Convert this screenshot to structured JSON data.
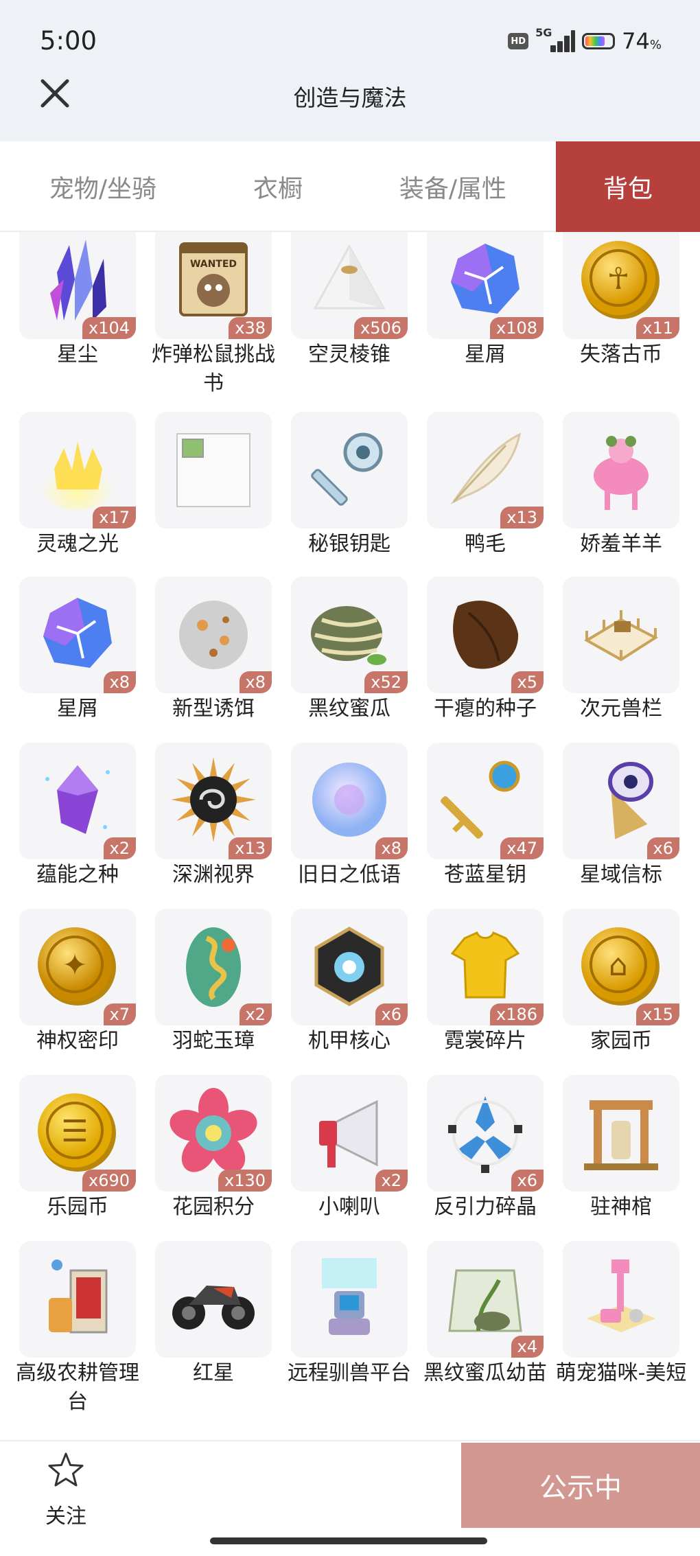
{
  "status_bar": {
    "time": "5:00",
    "hd": "HD",
    "network": "5G",
    "battery": "74",
    "battery_unit": "%"
  },
  "header": {
    "title": "创造与魔法"
  },
  "tabs": [
    {
      "label": "宠物/坐骑"
    },
    {
      "label": "衣橱"
    },
    {
      "label": "装备/属性"
    },
    {
      "label": "背包",
      "active": true
    }
  ],
  "items": [
    {
      "name": "星尘",
      "qty": "x104",
      "icon": "crystal-cluster-icon"
    },
    {
      "name": "炸弹松鼠挑战书",
      "qty": "x38",
      "icon": "wanted-scroll-icon"
    },
    {
      "name": "空灵棱锥",
      "qty": "x506",
      "icon": "pyramid-icon"
    },
    {
      "name": "星屑",
      "qty": "x108",
      "icon": "star-shard-icon"
    },
    {
      "name": "失落古币",
      "qty": "x11",
      "icon": "ankh-coin-icon"
    },
    {
      "name": "灵魂之光",
      "qty": "x17",
      "icon": "soul-light-icon"
    },
    {
      "name": "",
      "qty": "",
      "icon": "broken-image-icon"
    },
    {
      "name": "秘银钥匙",
      "qty": "",
      "icon": "mithril-key-icon"
    },
    {
      "name": "鸭毛",
      "qty": "x13",
      "icon": "feather-icon"
    },
    {
      "name": "娇羞羊羊",
      "qty": "",
      "icon": "pink-sheep-icon"
    },
    {
      "name": "星屑",
      "qty": "x8",
      "icon": "star-shard-icon"
    },
    {
      "name": "新型诱饵",
      "qty": "x8",
      "icon": "bait-ball-icon"
    },
    {
      "name": "黑纹蜜瓜",
      "qty": "x52",
      "icon": "melon-icon"
    },
    {
      "name": "干瘪的种子",
      "qty": "x5",
      "icon": "dried-seed-icon"
    },
    {
      "name": "次元兽栏",
      "qty": "",
      "icon": "fence-pen-icon"
    },
    {
      "name": "蕴能之种",
      "qty": "x2",
      "icon": "purple-crystal-icon"
    },
    {
      "name": "深渊视界",
      "qty": "x13",
      "icon": "abyss-eye-icon"
    },
    {
      "name": "旧日之低语",
      "qty": "x8",
      "icon": "bubble-orb-icon"
    },
    {
      "name": "苍蓝星钥",
      "qty": "x47",
      "icon": "blue-key-icon"
    },
    {
      "name": "星域信标",
      "qty": "x6",
      "icon": "beacon-icon"
    },
    {
      "name": "神权密印",
      "qty": "x7",
      "icon": "seal-coin-icon"
    },
    {
      "name": "羽蛇玉璋",
      "qty": "x2",
      "icon": "jade-serpent-icon"
    },
    {
      "name": "机甲核心",
      "qty": "x6",
      "icon": "mech-core-icon"
    },
    {
      "name": "霓裳碎片",
      "qty": "x186",
      "icon": "shirt-fragment-icon"
    },
    {
      "name": "家园币",
      "qty": "x15",
      "icon": "home-coin-icon"
    },
    {
      "name": "乐园币",
      "qty": "x690",
      "icon": "park-coin-icon"
    },
    {
      "name": "花园积分",
      "qty": "x130",
      "icon": "flower-badge-icon"
    },
    {
      "name": "小喇叭",
      "qty": "x2",
      "icon": "megaphone-icon"
    },
    {
      "name": "反引力碎晶",
      "qty": "x6",
      "icon": "antigravity-crystal-icon"
    },
    {
      "name": "驻神棺",
      "qty": "",
      "icon": "shrine-icon"
    },
    {
      "name": "高级农耕管理台",
      "qty": "",
      "icon": "farm-console-icon"
    },
    {
      "name": "红星",
      "qty": "",
      "icon": "motorcycle-icon"
    },
    {
      "name": "远程驯兽平台",
      "qty": "",
      "icon": "taming-platform-icon"
    },
    {
      "name": "黑纹蜜瓜幼苗",
      "qty": "x4",
      "icon": "seed-bag-icon"
    },
    {
      "name": "萌宠猫咪-美短",
      "qty": "",
      "icon": "cat-tree-icon"
    }
  ],
  "bottom_bar": {
    "follow_label": "关注",
    "action_label": "公示中"
  },
  "colors": {
    "accent": "#b5403c",
    "qty_badge": "#c77469",
    "action_button": "#d39791"
  }
}
